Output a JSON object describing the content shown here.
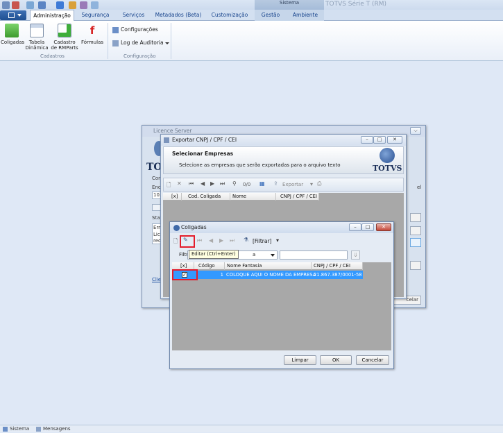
{
  "context_tab_group": "Sistema",
  "app_title": "TOTVS Série T (RM)",
  "ribbon_tabs": [
    {
      "label": "Administração",
      "active": true
    },
    {
      "label": "Segurança"
    },
    {
      "label": "Serviços"
    },
    {
      "label": "Metadados (Beta)"
    },
    {
      "label": "Customização"
    },
    {
      "label": "Gestão"
    },
    {
      "label": "Ambiente"
    }
  ],
  "ribbon": {
    "cadastros": {
      "group_label": "Cadastros",
      "coligadas": "Coligadas",
      "tabela_dinamica_1": "Tabela",
      "tabela_dinamica_2": "Dinâmica",
      "cadastro_rmparts_1": "Cadastro",
      "cadastro_rmparts_2": "de RMParts",
      "formulas": "Fórmulas"
    },
    "configuracao": {
      "group_label": "Configuração",
      "configuracoes": "Configurações",
      "log_auditoria": "Log de Auditoria"
    }
  },
  "license_window": {
    "title": "Licence Server",
    "fragments": [
      "Con",
      "End",
      "10.",
      "Stat",
      "Erro",
      "Lice",
      "redu",
      "Clie",
      "el",
      "celar"
    ]
  },
  "export_window": {
    "title": "Exportar CNPJ / CPF / CEI",
    "header_title": "Selecionar Empresas",
    "header_subtitle": "Selecione as empresas que serão exportadas para o arquivo texto",
    "logo_text": "TOTVS",
    "counter": "0/0",
    "export_label": "Exportar",
    "columns": [
      "[x]",
      "Cod. Coligada",
      "Nome",
      "CNPJ / CPF / CEI"
    ]
  },
  "coligadas_window": {
    "title": "Coligadas",
    "filter_button": "[Filtrar]",
    "filter_label_visible": "Filtr",
    "filter_select_visible": "a",
    "tooltip": "Editar (Ctrl+Enter)",
    "columns": [
      "[x]",
      "Código",
      "Nome Fantasia",
      "CNPJ / CPF / CEI"
    ],
    "rows": [
      {
        "checked": true,
        "codigo": "1",
        "nome": "COLOQUE AQUI O NOME DA EMPRESA",
        "cnpj": "21.867.387/0001-58"
      }
    ],
    "buttons": {
      "clear": "Limpar",
      "ok": "OK",
      "cancel": "Cancelar"
    }
  },
  "statusbar": {
    "left": "Sistema",
    "right": "Mensagens"
  },
  "colors": {
    "selection": "#3399ff",
    "highlight": "#e41c2b",
    "grid_bg": "#a8a8a8",
    "desktop": "#dfe8f6"
  }
}
